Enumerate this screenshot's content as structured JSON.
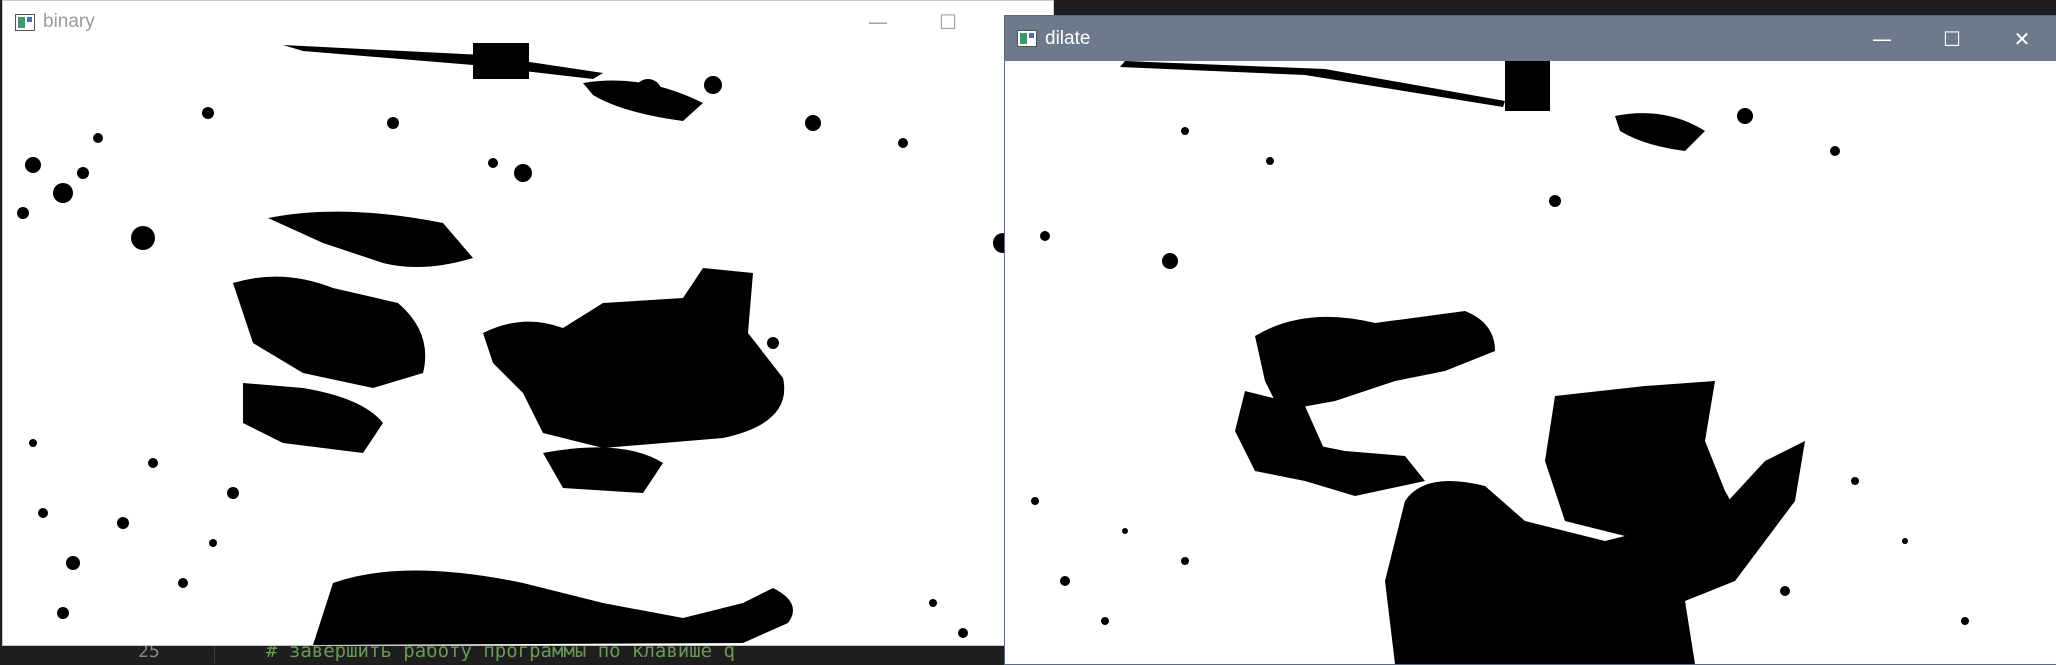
{
  "editor": {
    "line_number": "25",
    "code_line": "# завершить работу программы по клавише q"
  },
  "windows": [
    {
      "title": "binary",
      "icon": "app-image-icon",
      "controls": {
        "minimize": "—",
        "maximize": "☐",
        "close": "✕"
      }
    },
    {
      "title": "dilate",
      "icon": "app-image-icon",
      "controls": {
        "minimize": "—",
        "maximize": "☐",
        "close": "✕"
      }
    }
  ],
  "colors": {
    "active_titlebar": "#6c7a8c",
    "inactive_titlebar": "#ffffff",
    "foreground_mask": "#000000",
    "background_mask": "#ffffff",
    "editor_comment": "#6a9955"
  }
}
